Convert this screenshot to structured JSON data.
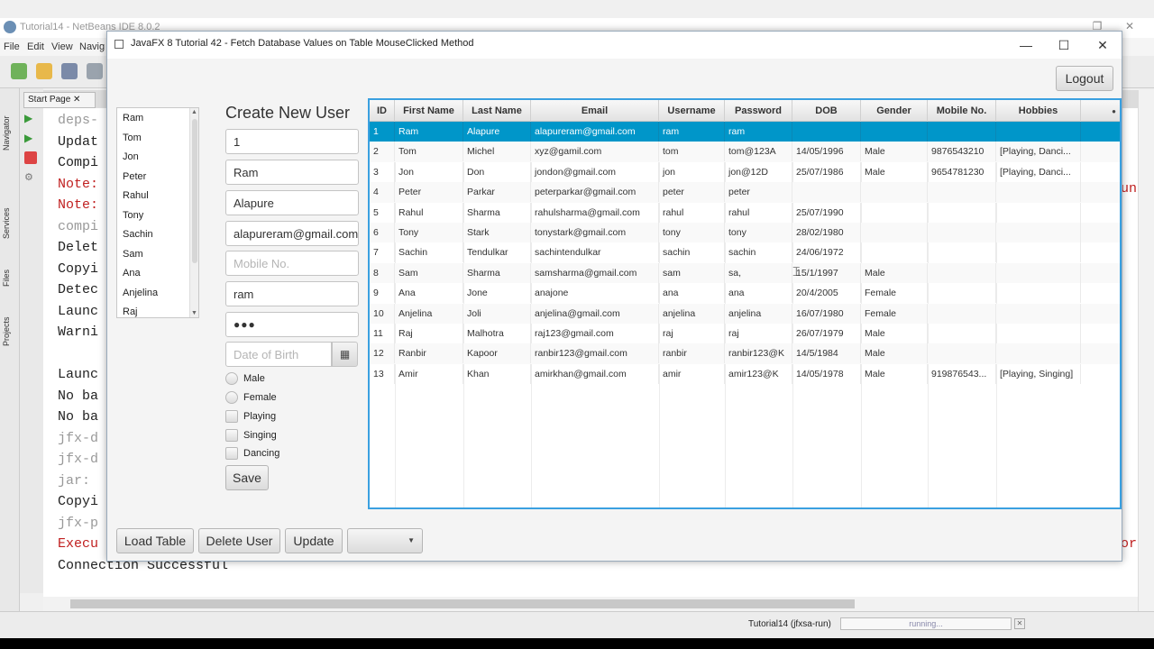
{
  "ide": {
    "title": "Tutorial14 - NetBeans IDE 8.0.2",
    "menu": [
      "File",
      "Edit",
      "View",
      "Navig"
    ],
    "tab": "Start Page",
    "side_tabs": [
      "Navigator",
      "Services",
      "Files",
      "Projects"
    ],
    "output_lines": [
      {
        "text": "deps-",
        "color": "#999999"
      },
      {
        "text": "Updat",
        "color": "#222222"
      },
      {
        "text": "Compi",
        "color": "#222222"
      },
      {
        "text": "Note:",
        "color": "#c02020"
      },
      {
        "text": "Note:",
        "color": "#c02020"
      },
      {
        "text": "compi",
        "color": "#999999"
      },
      {
        "text": "Delet",
        "color": "#222222"
      },
      {
        "text": "Copyi",
        "color": "#222222"
      },
      {
        "text": "Detec",
        "color": "#222222"
      },
      {
        "text": "Launc",
        "color": "#222222"
      },
      {
        "text": "Warni",
        "color": "#222222"
      },
      {
        "text": "",
        "color": "#222222"
      },
      {
        "text": "Launc",
        "color": "#222222"
      },
      {
        "text": "No ba",
        "color": "#222222"
      },
      {
        "text": "No ba",
        "color": "#222222"
      },
      {
        "text": "jfx-d",
        "color": "#999999"
      },
      {
        "text": "jfx-d",
        "color": "#999999"
      },
      {
        "text": "jar:",
        "color": "#999999"
      },
      {
        "text": "Copyi",
        "color": "#222222"
      },
      {
        "text": "jfx-p",
        "color": "#999999"
      },
      {
        "text": "Execu",
        "color": "#c02020"
      },
      {
        "text": "Connection Successful",
        "color": "#222222"
      }
    ],
    "right_clip_1": "un",
    "right_clip_2": "or",
    "status_text": "Tutorial14 (jfxsa-run)",
    "progress_text": "running..."
  },
  "window": {
    "title": "JavaFX 8 Tutorial 42 - Fetch Database Values on Table MouseClicked Method",
    "minimize": "—",
    "maximize": "☐",
    "close": "✕"
  },
  "logout_label": "Logout",
  "names_list": [
    "Ram",
    "Tom",
    "Jon",
    "Peter",
    "Rahul",
    "Tony",
    "Sachin",
    "Sam",
    "Ana",
    "Anjelina",
    "Raj"
  ],
  "form": {
    "title": "Create New User",
    "id_value": "1",
    "first_name_value": "Ram",
    "last_name_value": "Alapure",
    "email_value": "alapureram@gmail.com",
    "mobile_placeholder": "Mobile No.",
    "username_value": "ram",
    "password_value": "●●●",
    "dob_placeholder": "Date of Birth",
    "male_label": "Male",
    "female_label": "Female",
    "playing_label": "Playing",
    "singing_label": "Singing",
    "dancing_label": "Dancing",
    "save_label": "Save"
  },
  "table": {
    "columns": [
      "ID",
      "First Name",
      "Last Name",
      "Email",
      "Username",
      "Password",
      "DOB",
      "Gender",
      "Mobile No.",
      "Hobbies"
    ],
    "rows": [
      [
        "1",
        "Ram",
        "Alapure",
        "alapureram@gmail.com",
        "ram",
        "ram",
        "",
        "",
        "",
        ""
      ],
      [
        "2",
        "Tom",
        "Michel",
        "xyz@gamil.com",
        "tom",
        "tom@123A",
        "14/05/1996",
        "Male",
        "9876543210",
        "[Playing, Danci..."
      ],
      [
        "3",
        "Jon",
        "Don",
        "jondon@gmail.com",
        "jon",
        "jon@12D",
        "25/07/1986",
        "Male",
        "9654781230",
        "[Playing, Danci..."
      ],
      [
        "4",
        "Peter",
        "Parkar",
        "peterparkar@gmail.com",
        "peter",
        "peter",
        "",
        "",
        "",
        ""
      ],
      [
        "5",
        "Rahul",
        "Sharma",
        "rahulsharma@gmail.com",
        "rahul",
        "rahul",
        "25/07/1990",
        "",
        "",
        ""
      ],
      [
        "6",
        "Tony",
        "Stark",
        "tonystark@gmail.com",
        "tony",
        "tony",
        "28/02/1980",
        "",
        "",
        ""
      ],
      [
        "7",
        "Sachin",
        "Tendulkar",
        "sachintendulkar",
        "sachin",
        "sachin",
        "24/06/1972",
        "",
        "",
        ""
      ],
      [
        "8",
        "Sam",
        "Sharma",
        "samsharma@gmail.com",
        "sam",
        "sa,",
        "15/1/1997",
        "Male",
        "",
        ""
      ],
      [
        "9",
        "Ana",
        "Jone",
        "anajone",
        "ana",
        "ana",
        "20/4/2005",
        "Female",
        "",
        ""
      ],
      [
        "10",
        "Anjelina",
        "Joli",
        "anjelina@gmail.com",
        "anjelina",
        "anjelina",
        "16/07/1980",
        "Female",
        "",
        ""
      ],
      [
        "11",
        "Raj",
        "Malhotra",
        "raj123@gmail.com",
        "raj",
        "raj",
        "26/07/1979",
        "Male",
        "",
        ""
      ],
      [
        "12",
        "Ranbir",
        "Kapoor",
        "ranbir123@gmail.com",
        "ranbir",
        "ranbir123@K",
        "14/5/1984",
        "Male",
        "",
        ""
      ],
      [
        "13",
        "Amir",
        "Khan",
        "amirkhan@gmail.com",
        "amir",
        "amir123@K",
        "14/05/1978",
        "Male",
        "919876543...",
        "[Playing, Singing]"
      ]
    ],
    "selected_row": 0
  },
  "buttons": {
    "load_table": "Load Table",
    "delete_user": "Delete User",
    "update": "Update"
  },
  "colors": {
    "selection": "#0096c9",
    "table_focus_border": "#3aa0e0"
  }
}
